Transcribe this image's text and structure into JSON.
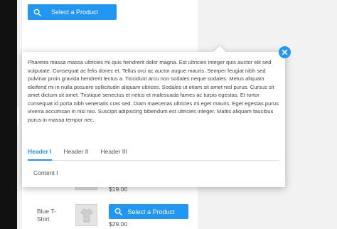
{
  "product_list": {
    "select_button_label": "Select a Product",
    "rows": [
      {
        "price": "$19.00"
      },
      {
        "name": "Blue T-Shirt",
        "price": "$29.00",
        "button_label": "Select a Product"
      }
    ]
  },
  "popover": {
    "body_text": "Pharetra massa massa ultricies mi quis hendrerit dolor magna. Est ultricies integer quis auctor elit sed vulputate. Consequat ac felis donec et. Tellus orci ac auctor augue mauris. Semper feugiat nibh sed pulvinar proin gravida hendrerit lectus a. Tincidunt arcu non sodales neque sodales. Metus aliquam eleifend mi in nulla posuere sollicitudin aliquam ultrices. Sodales ut etiam sit amet nisl purus. Cursus sit amet dictum sit amet. Tristique senectus et netus et malesuada fames ac turpis egestas. Et tortor consequat id porta nibh venenatis cras sed. Diam maecenas ultricies mi eget mauris. Eget egestas purus viverra accumsan in nisl nisi. Suscipit adipiscing bibendum est ultricies integer. Mattis aliquam faucibus purus in massa tempor nec.",
    "tabs": [
      {
        "label": "Header I",
        "active": true
      },
      {
        "label": "Header II",
        "active": false
      },
      {
        "label": "Header III",
        "active": false
      }
    ],
    "active_tab_content": "Content I"
  },
  "icons": {
    "search": "search-icon",
    "close": "close-icon",
    "thumbnail": "tshirt-thumbnail"
  },
  "colors": {
    "accent": "#2196f3",
    "left_rail": "#111111"
  }
}
